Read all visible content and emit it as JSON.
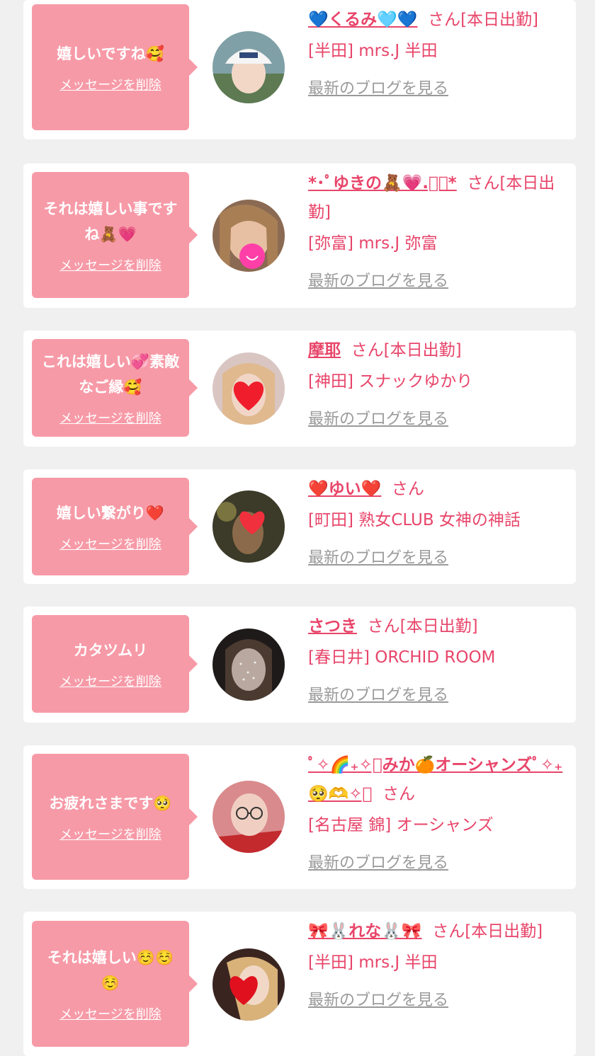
{
  "colors": {
    "page_bg": "#f0f0f0",
    "card_bg": "#ffffff",
    "bubble_bg": "#f79aa7",
    "accent_pink": "#e8456a",
    "link_gray": "#9a9a9a"
  },
  "delete_label": "メッセージを削除",
  "blog_label": "最新のブログを見る",
  "san_label": "さん",
  "items": [
    {
      "message": "嬉しいですね🥰",
      "name": "💙くるみ🩵💙",
      "suffix": "さん[本日出勤]",
      "shop": "[半田] mrs.J 半田",
      "avatar_icon": "profile-photo-white-cap"
    },
    {
      "message": "それは嬉しい事ですね🧸💗",
      "name": "*･ﾟゆきの🧸💗.ﾟ･*",
      "suffix": "さん[本日出勤]",
      "shop": "[弥富] mrs.J 弥富",
      "avatar_icon": "profile-photo-heart-smile"
    },
    {
      "message": "これは嬉しい💞素敵なご縁🥰",
      "name": "摩耶",
      "suffix": "さん[本日出勤]",
      "shop": "[神田] スナックゆかり",
      "avatar_icon": "profile-photo-red-heart"
    },
    {
      "message": "嬉しい繋がり❤️",
      "name": "❤️ゆい❤️",
      "suffix": "さん",
      "shop": "[町田] 熟女CLUB 女神の神話",
      "avatar_icon": "profile-photo-dark-heart"
    },
    {
      "message": "カタツムリ",
      "name": "さつき",
      "suffix": "さん[本日出勤]",
      "shop": "[春日井] ORCHID ROOM",
      "avatar_icon": "profile-photo-sparkle-filter"
    },
    {
      "message": "お疲れさまです🥺",
      "name": "ﾟ✧🌈₊✧ﾟみか🍊オーシャンズﾟ✧₊🥺🫶✧ﾟ",
      "suffix": "さん",
      "shop": "[名古屋 錦] オーシャンズ",
      "avatar_icon": "profile-photo-glasses"
    },
    {
      "message": "それは嬉しい☺️☺️☺️",
      "name": "🎀🐰れな🐰🎀",
      "suffix": "さん[本日出勤]",
      "shop": "[半田] mrs.J 半田",
      "avatar_icon": "profile-photo-blonde-heart"
    }
  ]
}
